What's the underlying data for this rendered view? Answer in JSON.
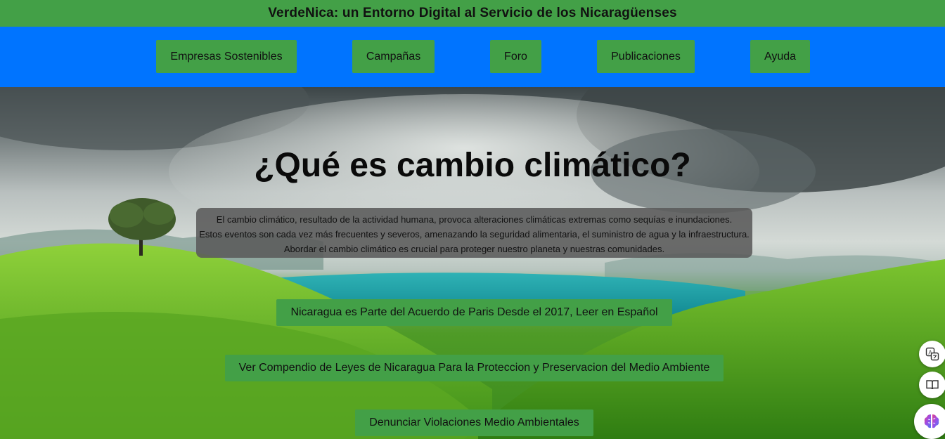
{
  "header": {
    "title": "VerdeNica: un Entorno Digital al Servicio de los Nicaragüenses"
  },
  "nav": {
    "items": [
      {
        "label": "Empresas Sostenibles"
      },
      {
        "label": "Campañas"
      },
      {
        "label": "Foro"
      },
      {
        "label": "Publicaciones"
      },
      {
        "label": "Ayuda"
      }
    ]
  },
  "hero": {
    "title": "¿Qué es cambio climático?",
    "description": [
      "El cambio climático, resultado de la actividad humana, provoca alteraciones climáticas extremas como sequías e inundaciones.",
      "Estos eventos son cada vez más frecuentes y severos, amenazando la seguridad alimentaria, el suministro de agua y la infraestructura.",
      "Abordar el cambio climático es crucial para proteger nuestro planeta y nuestras comunidades."
    ]
  },
  "actions": {
    "paris": "Nicaragua es Parte del Acuerdo de Paris Desde el 2017, Leer en Español",
    "laws": "Ver Compendio de Leyes de Nicaragua Para la Proteccion y Preservacion del Medio Ambiente",
    "report": "Denunciar Violaciones Medio Ambientales"
  },
  "floating_tools": [
    {
      "icon": "translate-icon"
    },
    {
      "icon": "reader-icon"
    },
    {
      "icon": "ai-brain-icon"
    }
  ],
  "colors": {
    "header_green": "#43a047",
    "nav_blue": "#0074ff",
    "button_green": "#43a047",
    "description_bg": "#5a5a5a"
  }
}
